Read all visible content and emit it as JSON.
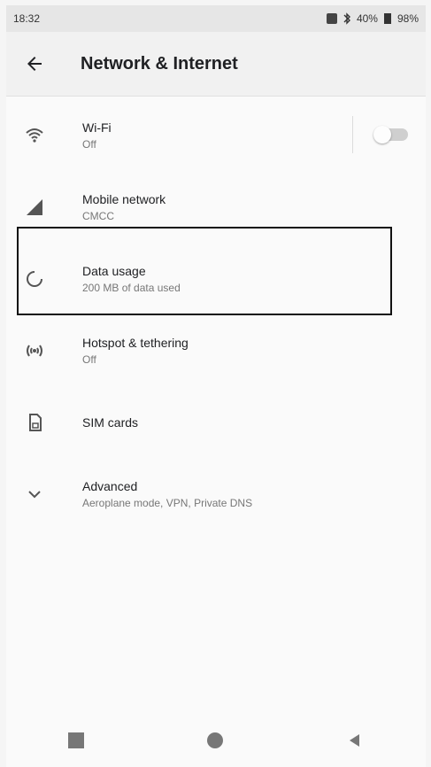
{
  "status_bar": {
    "time": "18:32",
    "network_label": "40%",
    "battery_label": "98%"
  },
  "toolbar": {
    "title": "Network & Internet"
  },
  "items": [
    {
      "title": "Wi-Fi",
      "subtitle": "Off",
      "icon": "wifi-icon"
    },
    {
      "title": "Mobile network",
      "subtitle": "CMCC",
      "icon": "signal-icon"
    },
    {
      "title": "Data usage",
      "subtitle": "200 MB of data used",
      "icon": "data-usage-icon"
    },
    {
      "title": "Hotspot & tethering",
      "subtitle": "Off",
      "icon": "hotspot-icon"
    },
    {
      "title": "SIM cards",
      "subtitle": "",
      "icon": "sim-card-icon"
    },
    {
      "title": "Advanced",
      "subtitle": "Aeroplane mode, VPN, Private DNS",
      "icon": "chevron-down-icon"
    }
  ],
  "colors": {
    "background": "#fafafa",
    "toolbar": "#f1f1f1",
    "icon": "#555555",
    "highlight": "#111111"
  }
}
